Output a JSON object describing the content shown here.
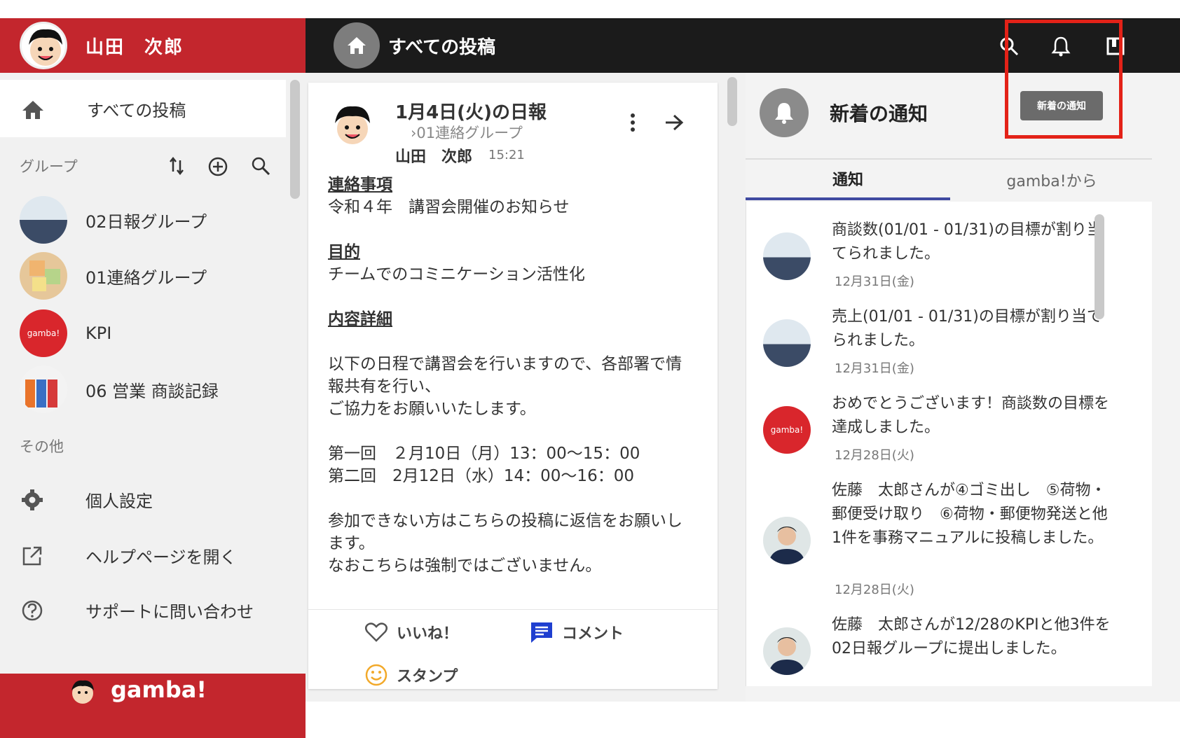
{
  "user": {
    "name": "山田　次郎"
  },
  "topbar": {
    "title": "すべての投稿"
  },
  "tooltip": "新着の通知",
  "sidebar": {
    "all_posts": "すべての投稿",
    "group_header": "グループ",
    "groups": [
      {
        "label": "02日報グループ"
      },
      {
        "label": "01連絡グループ"
      },
      {
        "label": "KPI",
        "avatar_text": "gamba!"
      },
      {
        "label": "06 営業 商談記録"
      }
    ],
    "other_header": "その他",
    "others": [
      {
        "label": "個人設定",
        "icon": "gear-icon"
      },
      {
        "label": "ヘルプページを開く",
        "icon": "external-link-icon"
      },
      {
        "label": "サポートに問い合わせ",
        "icon": "help-icon"
      }
    ],
    "brand": "gamba!"
  },
  "post": {
    "title": "1月4日(火)の日報",
    "group": "›01連絡グループ",
    "author": "山田　次郎",
    "time": "15:21",
    "sections": [
      {
        "heading": "連絡事項",
        "lines": [
          "令和４年　講習会開催のお知らせ"
        ]
      },
      {
        "heading": "目的",
        "lines": [
          "チームでのコミニケーション活性化"
        ]
      },
      {
        "heading": "内容詳細",
        "lines": [
          "",
          "以下の日程で講習会を行いますので、各部署で情",
          "報共有を行い、",
          "ご協力をお願いいたします。",
          "",
          "第一回　２月10日（月）13：00〜15：00",
          "第二回　2月12日（水）14：00〜16：00",
          "",
          "参加できない方はこちらの投稿に返信をお願いし",
          "ます。",
          "なおこちらは強制ではございません。"
        ]
      }
    ],
    "actions": {
      "like": "いいね！",
      "comment": "コメント",
      "stamp": "スタンプ"
    }
  },
  "notifications": {
    "title": "新着の通知",
    "tabs": [
      "通知",
      "gamba!から"
    ],
    "items": [
      {
        "text": "商談数(01/01 - 01/31)の目標が割り当てられました。",
        "date": "12月31日(金)",
        "avatar": "group-photo"
      },
      {
        "text": "売上(01/01 - 01/31)の目標が割り当てられました。",
        "date": "12月31日(金)",
        "avatar": "group-photo"
      },
      {
        "text": "おめでとうございます！商談数の目標を達成しました。",
        "date": "12月28日(火)",
        "avatar": "gamba",
        "avatar_text": "gamba!"
      },
      {
        "text": "佐藤　太郎さんが④ゴミ出し　⑤荷物・郵便受け取り　⑥荷物・郵便物発送と他1件を事務マニュアルに投稿しました。",
        "date": "12月28日(火)",
        "avatar": "person"
      },
      {
        "text": "佐藤　太郎さんが12/28のKPIと他3件を02日報グループに提出しました。",
        "date": "",
        "avatar": "person"
      }
    ]
  },
  "colors": {
    "brand_red": "#c3262d",
    "topbar": "#1b1b1b",
    "tab_underline": "#3f4aa0",
    "highlight": "#e32218"
  }
}
